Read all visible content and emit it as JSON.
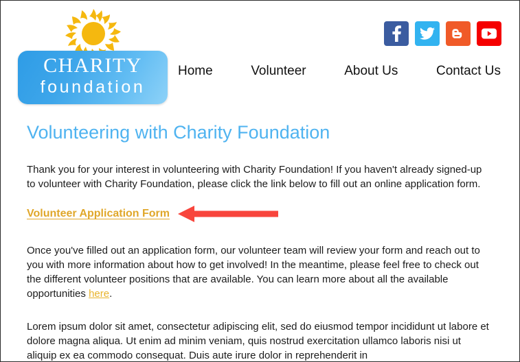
{
  "site": {
    "logo": {
      "icon": "sun-icon",
      "title_top": "CHARITY",
      "title_bottom": "foundation"
    },
    "nav": [
      {
        "label": "Home",
        "name": "nav-item-home"
      },
      {
        "label": "Volunteer",
        "name": "nav-item-volunteer"
      },
      {
        "label": "About Us",
        "name": "nav-item-about-us"
      },
      {
        "label": "Contact Us",
        "name": "nav-item-contact-us"
      }
    ],
    "social": [
      {
        "label": "Facebook",
        "icon": "facebook-icon",
        "color": "#3b5ca0"
      },
      {
        "label": "Twitter",
        "icon": "twitter-icon",
        "color": "#32b3f0"
      },
      {
        "label": "Blogger",
        "icon": "blogger-icon",
        "color": "#f05a28"
      },
      {
        "label": "YouTube",
        "icon": "youtube-icon",
        "color": "#f50000"
      }
    ]
  },
  "main": {
    "heading": "Volunteering with Charity Foundation",
    "paragraph_1": "Thank you for your interest in volunteering with Charity Foundation! If you haven't already signed-up to volunteer with Charity Foundation, please click the link below to fill out an online application form.",
    "cta_link_label": "Volunteer Application Form",
    "annotation_arrow": "red-left-arrow-annotation",
    "paragraph_2_before": "Once you've filled out an application form, our volunteer team will review your form and reach out to you with more information about how to get involved! In the meantime, please feel free to check out the different volunteer positions that are available. You can learn more about all the available opportunities ",
    "paragraph_2_link": "here",
    "paragraph_2_after": ".",
    "paragraph_3": "Lorem ipsum dolor sit amet, consectetur adipiscing elit, sed do eiusmod tempor incididunt ut labore et dolore magna aliqua. Ut enim ad minim veniam, quis nostrud exercitation ullamco laboris nisi ut aliquip ex ea commodo consequat. Duis aute irure dolor in reprehenderit in"
  },
  "colors": {
    "heading_blue": "#4fb3f0",
    "link_gold": "#e0a72a",
    "arrow_red": "#f8453c",
    "logo_blue": "#3ea6ea",
    "sun_gold": "#f5b80f"
  }
}
